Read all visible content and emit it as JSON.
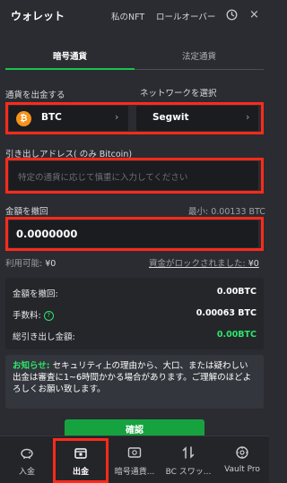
{
  "header": {
    "title": "ウォレット",
    "nav_nft": "私のNFT",
    "nav_rollover": "ロールオーバー",
    "close_symbol": "×"
  },
  "tabs": [
    {
      "label": "暗号通貨",
      "active": true
    },
    {
      "label": "法定通貨",
      "active": false
    }
  ],
  "withdraw": {
    "currency_label": "通貨を出金する",
    "network_label": "ネットワークを選択",
    "currency": {
      "symbol": "₿",
      "name": "BTC"
    },
    "network": {
      "name": "Segwit"
    },
    "address_label": "引き出しアドレス",
    "address_note": "( のみ Bitcoin)",
    "address_placeholder": "特定の通貨に応じて慎重に入力してください",
    "amount_label": "金額を撤回",
    "min_label": "最小: 0.00133 BTC",
    "amount_value": "0.0000000",
    "available_label": "利用可能: ",
    "available_value": "¥0",
    "locked_label": "資金がロックされました: ",
    "locked_value": "¥0"
  },
  "summary": {
    "rows": [
      {
        "label": "金額を撤回:",
        "value": "0.00BTC"
      },
      {
        "label": "手数料:",
        "value": "0.00063 BTC"
      },
      {
        "label": "総引き出し金額:",
        "value": "0.00BTC"
      }
    ]
  },
  "notice": {
    "prefix": "お知らせ:",
    "text": " セキュリティ上の理由から、大口、または疑わしい出金は審査に1~6時間かかる場合があります。ご理解のほどよろしくお願い致します。"
  },
  "confirm_label": "確認",
  "bottom_nav": [
    {
      "label": "入金",
      "icon": "piggy-bank-icon",
      "active": false
    },
    {
      "label": "出金",
      "icon": "withdraw-box-icon",
      "active": true
    },
    {
      "label": "暗号通貨...",
      "icon": "crypto-icon",
      "active": false
    },
    {
      "label": "BC スワッ...",
      "icon": "swap-icon",
      "active": false
    },
    {
      "label": "Vault Pro",
      "icon": "vault-icon",
      "active": false
    }
  ],
  "colors": {
    "accent_green": "#19c34c",
    "highlight_red": "#ff2a1a",
    "btc_orange": "#f7931a",
    "background": "#2a2c31"
  }
}
